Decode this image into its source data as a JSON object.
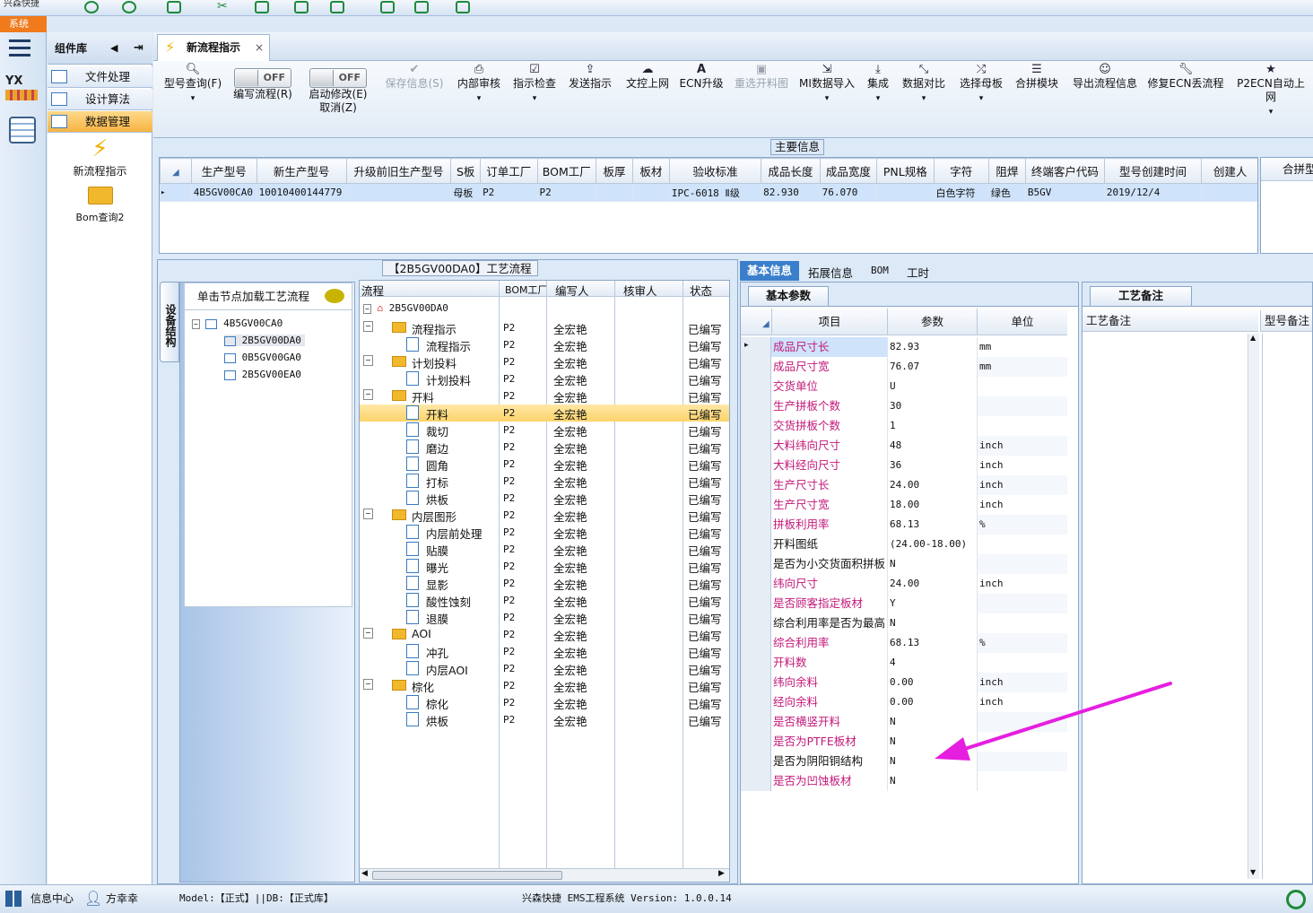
{
  "topstrip": {
    "app_title": "兴森快捷"
  },
  "system_tab": "系统",
  "sidebar": {
    "header": "组件库",
    "items": [
      {
        "label": "文件处理"
      },
      {
        "label": "设计算法"
      },
      {
        "label": "数据管理"
      }
    ],
    "tools": [
      {
        "label": "新流程指示"
      },
      {
        "label": "Bom查询2"
      }
    ]
  },
  "doc_tab": {
    "label": "新流程指示"
  },
  "toolbar": [
    {
      "label": "型号查询(F)",
      "icon": "search-icon"
    },
    {
      "label": "编写流程(R)",
      "toggle": "OFF"
    },
    {
      "label": "启动修改(E)",
      "label2": "取消(Z)",
      "toggle": "OFF"
    },
    {
      "label": "保存信息(S)",
      "icon": "check-icon",
      "disabled": true
    },
    {
      "label": "内部审核",
      "icon": "printer-icon"
    },
    {
      "label": "指示检查",
      "icon": "checkbox-icon"
    },
    {
      "label": "发送指示",
      "icon": "upload-icon"
    },
    {
      "label": "文控上网",
      "icon": "cloud-upload-icon"
    },
    {
      "label": "ECN升级",
      "icon": "font-icon"
    },
    {
      "label": "重选开料图",
      "icon": "image-icon",
      "disabled": true
    },
    {
      "label": "MI数据导入",
      "icon": "import-icon"
    },
    {
      "label": "集成",
      "icon": "download-icon"
    },
    {
      "label": "数据对比",
      "icon": "compress-icon"
    },
    {
      "label": "选择母板",
      "icon": "random-icon"
    },
    {
      "label": "合拼模块",
      "icon": "list-icon"
    },
    {
      "label": "导出流程信息",
      "icon": "smile-icon"
    },
    {
      "label": "修复ECN丢流程",
      "icon": "wrench-icon"
    },
    {
      "label": "P2ECN自动上网",
      "icon": "star-icon"
    }
  ],
  "main_info": {
    "caption": "主要信息",
    "columns": [
      "生产型号",
      "新生产型号",
      "升级前旧生产型号",
      "S板",
      "订单工厂",
      "BOM工厂",
      "板厚",
      "板材",
      "验收标准",
      "成品长度",
      "成品宽度",
      "PNL规格",
      "字符",
      "阻焊",
      "终端客户代码",
      "型号创建时间",
      "创建人"
    ],
    "row": [
      "4B5GV00CA0",
      "10010400144779",
      "",
      "母板",
      "P2",
      "P2",
      "",
      "",
      "IPC-6018 Ⅱ级",
      "82.930",
      "76.070",
      "",
      "白色字符",
      "绿色",
      "B5GV",
      "2019/12/4",
      ""
    ],
    "right_header": "合拼型"
  },
  "process": {
    "caption": "【2B5GV00DA0】工艺流程",
    "vertical_tab": "设备结构",
    "node_hint": "单击节点加载工艺流程",
    "tree": [
      "4B5GV00CA0",
      "2B5GV00DA0",
      "0B5GV00GA0",
      "2B5GV00EA0"
    ],
    "columns": [
      "流程",
      "BOM工厂",
      "编写人",
      "核审人",
      "状态"
    ],
    "root": "2B5GV00DA0",
    "rows": [
      {
        "name": "流程指示",
        "level": 1,
        "factory": "P2",
        "writer": "全宏艳",
        "status": "已编写"
      },
      {
        "name": "流程指示",
        "level": 2,
        "factory": "P2",
        "writer": "全宏艳",
        "status": "已编写"
      },
      {
        "name": "计划投料",
        "level": 1,
        "factory": "P2",
        "writer": "全宏艳",
        "status": "已编写"
      },
      {
        "name": "计划投料",
        "level": 2,
        "factory": "P2",
        "writer": "全宏艳",
        "status": "已编写"
      },
      {
        "name": "开料",
        "level": 1,
        "factory": "P2",
        "writer": "全宏艳",
        "status": "已编写"
      },
      {
        "name": "开料",
        "level": 2,
        "factory": "P2",
        "writer": "全宏艳",
        "status": "已编写",
        "selected": true
      },
      {
        "name": "裁切",
        "level": 2,
        "factory": "P2",
        "writer": "全宏艳",
        "status": "已编写"
      },
      {
        "name": "磨边",
        "level": 2,
        "factory": "P2",
        "writer": "全宏艳",
        "status": "已编写"
      },
      {
        "name": "圆角",
        "level": 2,
        "factory": "P2",
        "writer": "全宏艳",
        "status": "已编写"
      },
      {
        "name": "打标",
        "level": 2,
        "factory": "P2",
        "writer": "全宏艳",
        "status": "已编写"
      },
      {
        "name": "烘板",
        "level": 2,
        "factory": "P2",
        "writer": "全宏艳",
        "status": "已编写"
      },
      {
        "name": "内层图形",
        "level": 1,
        "factory": "P2",
        "writer": "全宏艳",
        "status": "已编写"
      },
      {
        "name": "内层前处理",
        "level": 2,
        "factory": "P2",
        "writer": "全宏艳",
        "status": "已编写"
      },
      {
        "name": "贴膜",
        "level": 2,
        "factory": "P2",
        "writer": "全宏艳",
        "status": "已编写"
      },
      {
        "name": "曝光",
        "level": 2,
        "factory": "P2",
        "writer": "全宏艳",
        "status": "已编写"
      },
      {
        "name": "显影",
        "level": 2,
        "factory": "P2",
        "writer": "全宏艳",
        "status": "已编写"
      },
      {
        "name": "酸性蚀刻",
        "level": 2,
        "factory": "P2",
        "writer": "全宏艳",
        "status": "已编写"
      },
      {
        "name": "退膜",
        "level": 2,
        "factory": "P2",
        "writer": "全宏艳",
        "status": "已编写"
      },
      {
        "name": "AOI",
        "level": 1,
        "factory": "P2",
        "writer": "全宏艳",
        "status": "已编写"
      },
      {
        "name": "冲孔",
        "level": 2,
        "factory": "P2",
        "writer": "全宏艳",
        "status": "已编写"
      },
      {
        "name": "内层AOI",
        "level": 2,
        "factory": "P2",
        "writer": "全宏艳",
        "status": "已编写"
      },
      {
        "name": "棕化",
        "level": 1,
        "factory": "P2",
        "writer": "全宏艳",
        "status": "已编写"
      },
      {
        "name": "棕化",
        "level": 2,
        "factory": "P2",
        "writer": "全宏艳",
        "status": "已编写"
      },
      {
        "name": "烘板",
        "level": 2,
        "factory": "P2",
        "writer": "全宏艳",
        "status": "已编写"
      }
    ]
  },
  "detail_tabs": [
    "基本信息",
    "拓展信息",
    "BOM",
    "工时"
  ],
  "basic_params": {
    "tab": "基本参数",
    "columns": [
      "项目",
      "参数",
      "单位"
    ],
    "rows": [
      {
        "item": "成品尺寸长",
        "value": "82.93",
        "unit": "mm",
        "pink": true
      },
      {
        "item": "成品尺寸宽",
        "value": "76.07",
        "unit": "mm",
        "pink": true
      },
      {
        "item": "交货单位",
        "value": "U",
        "unit": "",
        "pink": true
      },
      {
        "item": "生产拼板个数",
        "value": "30",
        "unit": "",
        "pink": true
      },
      {
        "item": "交货拼板个数",
        "value": "1",
        "unit": "",
        "pink": true
      },
      {
        "item": "大料纬向尺寸",
        "value": "48",
        "unit": "inch",
        "pink": true
      },
      {
        "item": "大料经向尺寸",
        "value": "36",
        "unit": "inch",
        "pink": true
      },
      {
        "item": "生产尺寸长",
        "value": "24.00",
        "unit": "inch",
        "pink": true
      },
      {
        "item": "生产尺寸宽",
        "value": "18.00",
        "unit": "inch",
        "pink": true
      },
      {
        "item": "拼板利用率",
        "value": "68.13",
        "unit": "%",
        "pink": true
      },
      {
        "item": "开料图纸",
        "value": "(24.00-18.00)",
        "unit": "",
        "pink": false
      },
      {
        "item": "是否为小交货面积拼板",
        "value": "N",
        "unit": "",
        "pink": false
      },
      {
        "item": "纬向尺寸",
        "value": "24.00",
        "unit": "inch",
        "pink": true
      },
      {
        "item": "是否顾客指定板材",
        "value": "Y",
        "unit": "",
        "pink": true
      },
      {
        "item": "综合利用率是否为最高",
        "value": "N",
        "unit": "",
        "pink": false
      },
      {
        "item": "综合利用率",
        "value": "68.13",
        "unit": "%",
        "pink": true
      },
      {
        "item": "开料数",
        "value": "4",
        "unit": "",
        "pink": true
      },
      {
        "item": "纬向余料",
        "value": "0.00",
        "unit": "inch",
        "pink": true
      },
      {
        "item": "经向余料",
        "value": "0.00",
        "unit": "inch",
        "pink": true
      },
      {
        "item": "是否横竖开料",
        "value": "N",
        "unit": "",
        "pink": true
      },
      {
        "item": "是否为PTFE板材",
        "value": "N",
        "unit": "",
        "pink": true
      },
      {
        "item": "是否为阴阳铜结构",
        "value": "N",
        "unit": "",
        "pink": false
      },
      {
        "item": "是否为凹蚀板材",
        "value": "N",
        "unit": "",
        "pink": true
      }
    ]
  },
  "process_notes": {
    "tab": "工艺备注",
    "col1": "工艺备注",
    "col2": "型号备注"
  },
  "status_bar": {
    "info_center": "信息中心",
    "user": "方幸幸",
    "mode": "Model:【正式】||DB:【正式库】",
    "app": "兴森快捷 EMS工程系统 Version: 1.0.0.14"
  },
  "colors": {
    "accent": "#3b7fcc",
    "selected": "#fcd36b",
    "pink": "#c2187a",
    "arrow": "#e61ee0"
  }
}
